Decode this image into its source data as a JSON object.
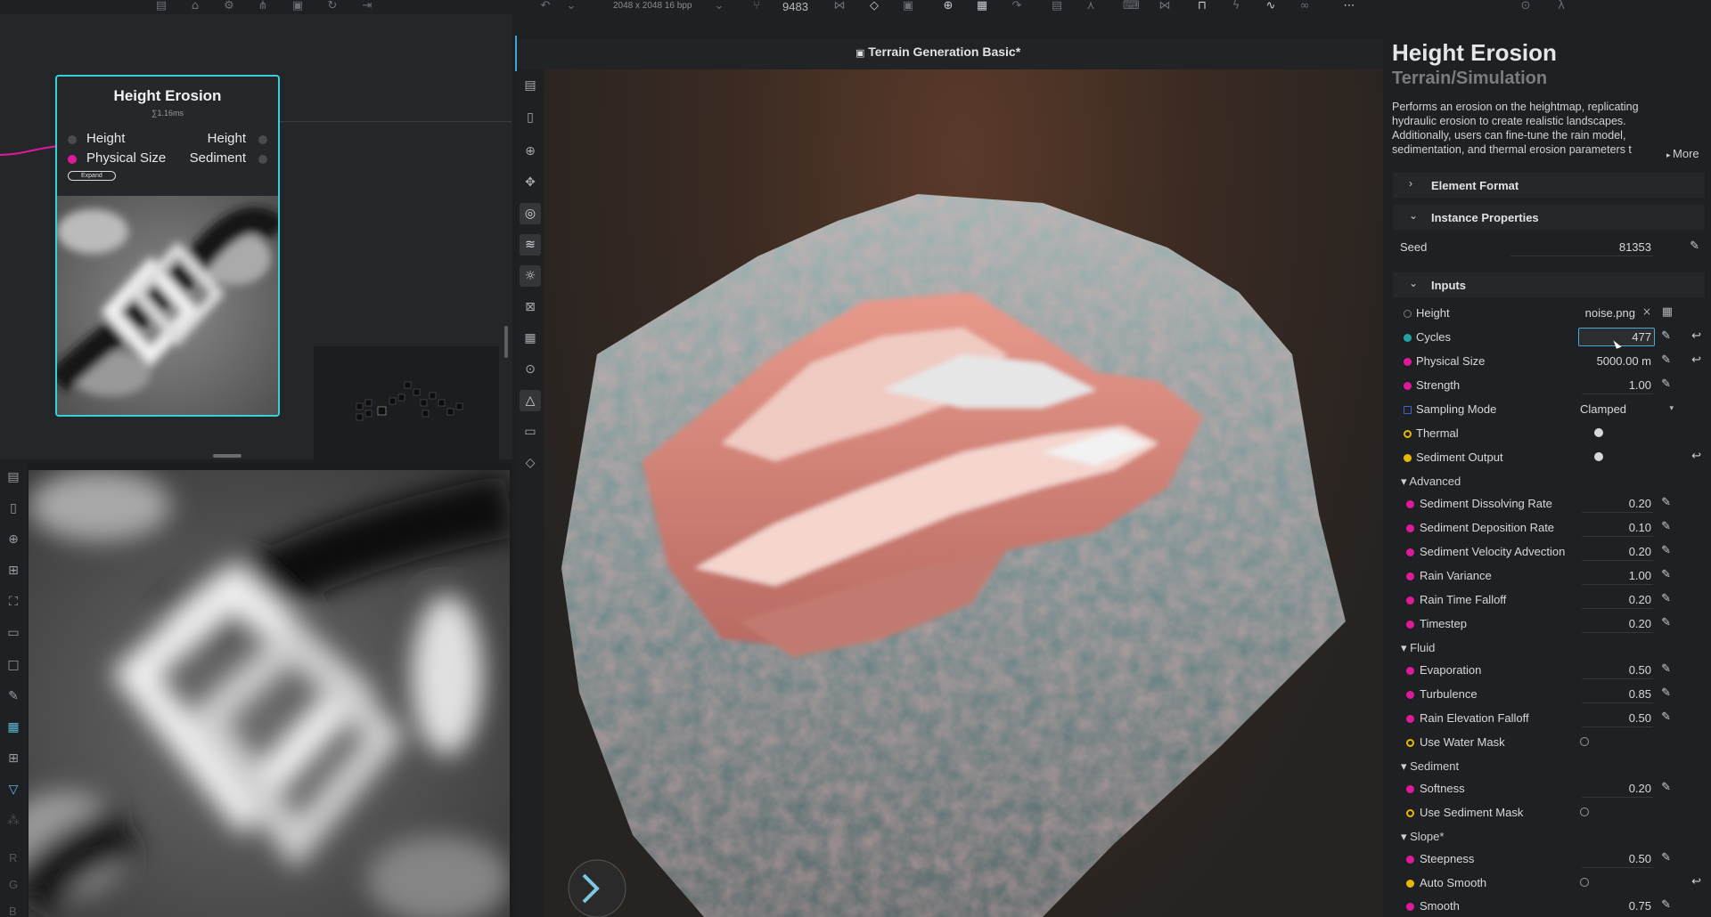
{
  "toolbar": {
    "resolution": "2048 x 2048 16 bpp",
    "count": "9483"
  },
  "node": {
    "title": "Height Erosion",
    "time": "∑1.16ms",
    "in_ports": [
      "Height",
      "Physical Size"
    ],
    "out_ports": [
      "Height",
      "Sediment"
    ],
    "expand_label": "Expand"
  },
  "viewport": {
    "title": "Terrain Generation Basic*"
  },
  "left_tool_letters": [
    "R",
    "G",
    "B"
  ],
  "panel": {
    "title": "Height Erosion",
    "subtitle": "Terrain/Simulation",
    "description": "Performs an erosion on the heightmap, replicating hydraulic erosion to create realistic landscapes. Additionally, users can fine-tune the rain model, sedimentation, and thermal erosion parameters t",
    "more_label": "More",
    "sections": {
      "element_format": "Element Format",
      "instance_properties": "Instance Properties",
      "inputs": "Inputs"
    },
    "seed": {
      "label": "Seed",
      "value": "81353"
    },
    "height": {
      "label": "Height",
      "value": "noise.png"
    },
    "cycles": {
      "label": "Cycles",
      "value": "477"
    },
    "physical_size": {
      "label": "Physical Size",
      "value": "5000.00 m"
    },
    "strength": {
      "label": "Strength",
      "value": "1.00"
    },
    "sampling_mode": {
      "label": "Sampling Mode",
      "value": "Clamped"
    },
    "thermal": {
      "label": "Thermal"
    },
    "sediment_output": {
      "label": "Sediment Output"
    },
    "groups": {
      "advanced": "Advanced",
      "fluid": "Fluid",
      "sediment": "Sediment",
      "slope": "Slope*"
    },
    "advanced": [
      {
        "label": "Sediment Dissolving Rate",
        "value": "0.20"
      },
      {
        "label": "Sediment Deposition Rate",
        "value": "0.10"
      },
      {
        "label": "Sediment Velocity Advection",
        "value": "0.20"
      },
      {
        "label": "Rain Variance",
        "value": "1.00"
      },
      {
        "label": "Rain Time Falloff",
        "value": "0.20"
      },
      {
        "label": "Timestep",
        "value": "0.20"
      }
    ],
    "fluid": [
      {
        "label": "Evaporation",
        "value": "0.50"
      },
      {
        "label": "Turbulence",
        "value": "0.85"
      },
      {
        "label": "Rain Elevation Falloff",
        "value": "0.50"
      }
    ],
    "use_water_mask": {
      "label": "Use Water Mask"
    },
    "softness": {
      "label": "Softness",
      "value": "0.20"
    },
    "use_sediment_mask": {
      "label": "Use Sediment Mask"
    },
    "steepness": {
      "label": "Steepness",
      "value": "0.50"
    },
    "auto_smooth": {
      "label": "Auto Smooth"
    },
    "smooth": {
      "label": "Smooth",
      "value": "0.75"
    }
  },
  "colors": {
    "accent_cyan": "#38d0d6",
    "magenta": "#e0199a",
    "teal": "#1fa3a3",
    "yellow": "#e6b800",
    "blue": "#3a63d6"
  }
}
